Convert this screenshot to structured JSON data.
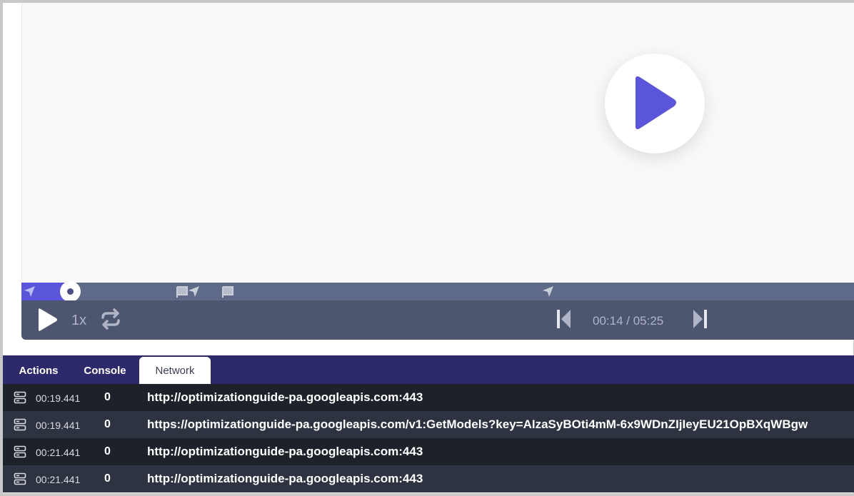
{
  "player": {
    "progress_fraction": 0.058,
    "controls": {
      "speed_label": "1x",
      "time_label": "00:14 / 05:25"
    },
    "colors": {
      "accent": "#5b55db",
      "timeline": "#5f6a88",
      "controls_bg": "#4d566e"
    }
  },
  "tabs": [
    {
      "label": "Actions",
      "active": false
    },
    {
      "label": "Console",
      "active": false
    },
    {
      "label": "Network",
      "active": true
    }
  ],
  "network": {
    "rows": [
      {
        "icon": "server-icon",
        "time": "00:19.441",
        "status": "0",
        "url": "http://optimizationguide-pa.googleapis.com:443"
      },
      {
        "icon": "server-icon",
        "time": "00:19.441",
        "status": "0",
        "url": "https://optimizationguide-pa.googleapis.com/v1:GetModels?key=AIzaSyBOti4mM-6x9WDnZIjIeyEU21OpBXqWBgw"
      },
      {
        "icon": "server-icon",
        "time": "00:21.441",
        "status": "0",
        "url": "http://optimizationguide-pa.googleapis.com:443"
      },
      {
        "icon": "server-icon",
        "time": "00:21.441",
        "status": "0",
        "url": "http://optimizationguide-pa.googleapis.com:443"
      }
    ]
  }
}
